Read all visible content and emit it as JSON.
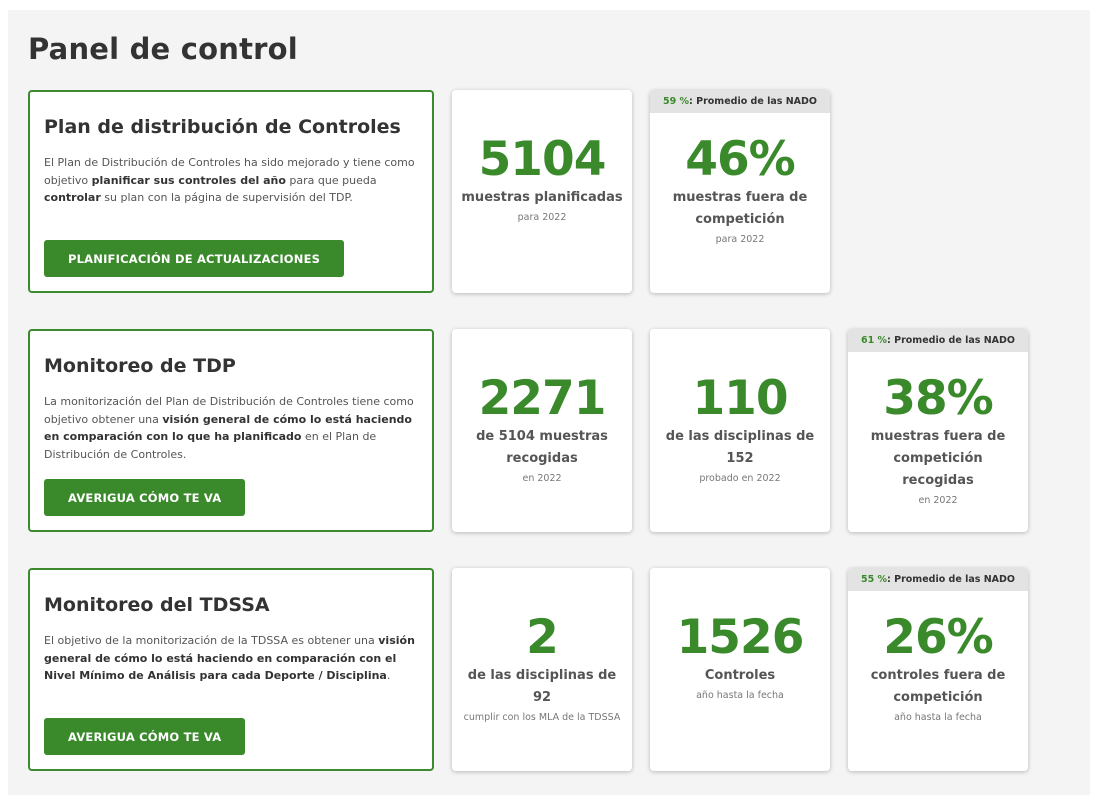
{
  "page": {
    "title": "Panel de control"
  },
  "sections": [
    {
      "heading": "Plan de distribución de Controles",
      "paragraph": [
        {
          "t": "El Plan de Distribución de Controles ha sido mejorado y tiene como objetivo "
        },
        {
          "t": "planificar sus controles del año",
          "b": true
        },
        {
          "t": " para que pueda "
        },
        {
          "t": "controlar",
          "b": true
        },
        {
          "t": " su plan con la página de supervisión del TDP."
        }
      ],
      "button": "PLANIFICACIÓN DE ACTUALIZACIONES",
      "cards": [
        {
          "value": "5104",
          "label": "muestras planificadas",
          "sub": "para 2022"
        },
        {
          "badge_pct": "59 %",
          "badge_text": " : Promedio de las NADO",
          "value": "46%",
          "label": "muestras fuera de competición",
          "sub": "para 2022"
        }
      ]
    },
    {
      "heading": "Monitoreo de TDP",
      "paragraph": [
        {
          "t": "La monitorización del Plan de Distribución de Controles tiene como objetivo obtener una "
        },
        {
          "t": "visión general de cómo lo está haciendo en comparación con lo que ha planificado",
          "b": true
        },
        {
          "t": " en el Plan de Distribución de Controles."
        }
      ],
      "button": "AVERIGUA CÓMO TE VA",
      "cards": [
        {
          "value": "2271",
          "label": "de 5104 muestras recogidas",
          "sub": "en 2022"
        },
        {
          "value": "110",
          "label": "de las disciplinas de 152",
          "sub": "probado en 2022"
        },
        {
          "badge_pct": "61 %",
          "badge_text": " : Promedio de las NADO",
          "value": "38%",
          "label": "muestras fuera de competición recogidas",
          "sub": "en 2022"
        }
      ]
    },
    {
      "heading": "Monitoreo del TDSSA",
      "paragraph": [
        {
          "t": "El objetivo de la monitorización de la TDSSA es obtener una "
        },
        {
          "t": "visión general de cómo lo está haciendo en comparación con el Nivel Mínimo de Análisis para cada Deporte / Disciplina",
          "b": true
        },
        {
          "t": "."
        }
      ],
      "button": "AVERIGUA CÓMO TE VA",
      "cards": [
        {
          "value": "2",
          "label": "de las disciplinas de 92",
          "sub": "cumplir con los MLA de la TDSSA"
        },
        {
          "value": "1526",
          "label": "Controles",
          "sub": "año hasta la fecha"
        },
        {
          "badge_pct": "55 %",
          "badge_text": " : Promedio de las NADO",
          "value": "26%",
          "label": "controles fuera de competición",
          "sub": "año hasta la fecha"
        }
      ]
    }
  ]
}
